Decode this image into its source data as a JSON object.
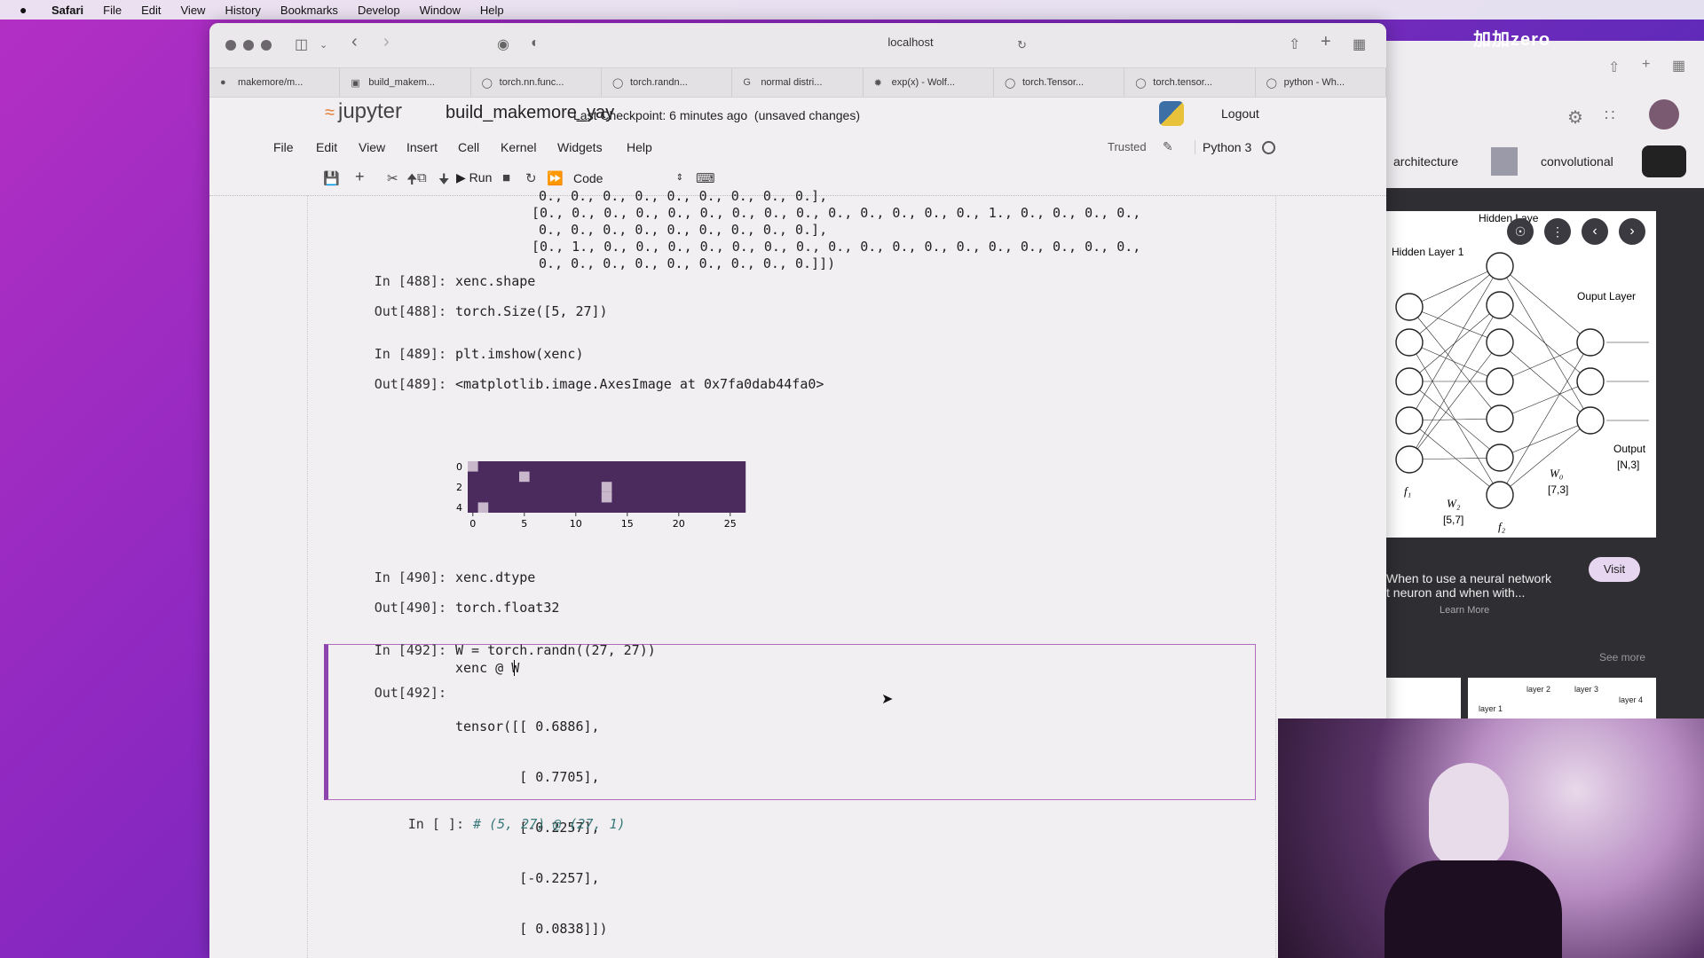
{
  "menubar": {
    "apple": "",
    "items": [
      "Safari",
      "File",
      "Edit",
      "View",
      "History",
      "Bookmarks",
      "Develop",
      "Window",
      "Help"
    ]
  },
  "safari": {
    "address": "localhost",
    "tabs": [
      {
        "label": "makemore/m...",
        "icon": "github-icon"
      },
      {
        "label": "build_makem...",
        "icon": "notebook-icon"
      },
      {
        "label": "torch.nn.func...",
        "icon": "pytorch-icon"
      },
      {
        "label": "torch.randn...",
        "icon": "pytorch-icon"
      },
      {
        "label": "normal distri...",
        "icon": "google-icon"
      },
      {
        "label": "exp(x) - Wolf...",
        "icon": "wolfram-icon"
      },
      {
        "label": "torch.Tensor...",
        "icon": "pytorch-icon"
      },
      {
        "label": "torch.tensor...",
        "icon": "pytorch-icon"
      },
      {
        "label": "python - Wh...",
        "icon": "stackoverflow-icon"
      }
    ]
  },
  "jupyter": {
    "logo": "jupyter",
    "notebook_name": "build_makemore_yay",
    "checkpoint": "Last Checkpoint: 6 minutes ago",
    "unsaved": "(unsaved changes)",
    "logout": "Logout",
    "menu": [
      "File",
      "Edit",
      "View",
      "Insert",
      "Cell",
      "Kernel",
      "Widgets",
      "Help"
    ],
    "trusted": "Trusted",
    "kernel": "Python 3",
    "run_label": "Run",
    "cell_type": "Code"
  },
  "notebook": {
    "array_lines": [
      "0., 0., 0., 0., 0., 0., 0., 0., 0.],",
      "[0., 0., 0., 0., 0., 0., 0., 0., 0., 0., 0., 0., 0., 0., 1., 0., 0., 0., 0.,",
      " 0., 0., 0., 0., 0., 0., 0., 0., 0.],",
      "[0., 1., 0., 0., 0., 0., 0., 0., 0., 0., 0., 0., 0., 0., 0., 0., 0., 0., 0.,",
      " 0., 0., 0., 0., 0., 0., 0., 0., 0.]])"
    ],
    "cells": [
      {
        "in_prompt": "In [488]:",
        "code": "xenc.shape",
        "out_prompt": "Out[488]:",
        "output": "torch.Size([5, 27])"
      },
      {
        "in_prompt": "In [489]:",
        "code": "plt.imshow(xenc)",
        "out_prompt": "Out[489]:",
        "output": "<matplotlib.image.AxesImage at 0x7fa0dab44fa0>"
      },
      {
        "in_prompt": "In [490]:",
        "code": "xenc.dtype",
        "out_prompt": "Out[490]:",
        "output": "torch.float32"
      },
      {
        "in_prompt": "In [492]:",
        "code_line1": "W = torch.randn((27, 27))",
        "code_line2": "xenc @ W",
        "out_prompt": "Out[492]:",
        "output_lines": [
          "tensor([[ 0.6886],",
          "        [ 0.7705],",
          "        [-0.2257],",
          "        [-0.2257],",
          "        [ 0.0838]])"
        ]
      },
      {
        "in_prompt": "In [ ]:",
        "code": "# (5, 27) @ (27, 1)"
      }
    ]
  },
  "chart_data": {
    "type": "heatmap",
    "title": "",
    "rows": 5,
    "cols": 27,
    "hot_cells": [
      [
        0,
        0
      ],
      [
        1,
        5
      ],
      [
        2,
        13
      ],
      [
        3,
        13
      ],
      [
        4,
        1
      ]
    ],
    "x_ticks": [
      "0",
      "5",
      "10",
      "15",
      "20",
      "25"
    ],
    "y_ticks": [
      "0",
      "2",
      "4"
    ],
    "colors": {
      "low": "#4b2a5e",
      "high": "#c9b8cc"
    }
  },
  "right_panel": {
    "banner": "加加zero",
    "chips": [
      "architecture",
      "convolutional"
    ],
    "image_labels": {
      "hidden1": "Hidden Layer 1",
      "hidden2": "Hidden Laye",
      "output_layer": "Ouput Layer",
      "output": "Output",
      "output_dim": "[N,3]",
      "w2": "W₂",
      "w2_dim": "[5,7]",
      "wo": "W₀",
      "wo_dim": "[7,3]",
      "f1": "f₁",
      "f2": "f₂"
    },
    "description_line1": "When to use a neural network",
    "description_line2": "t neuron and when with...",
    "learn_more": "Learn More",
    "visit": "Visit",
    "see_more": "See more",
    "thumb_labels": [
      "layer 1",
      "layer 2",
      "layer 3",
      "layer 4"
    ]
  }
}
